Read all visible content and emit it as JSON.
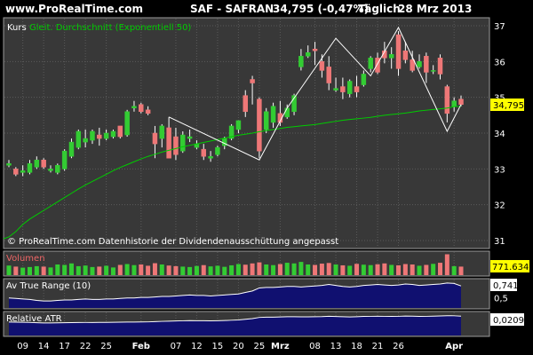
{
  "header": {
    "site": "www.ProRealTime.com",
    "symbol": "SAF - SAFRAN",
    "quote": "34,795 (-0,47%)",
    "period": "Täglich",
    "date": "28 Mrz 2013"
  },
  "colors": {
    "up": "#33cc33",
    "down": "#ee7777",
    "ema": "#00cc00",
    "zigzag": "#ffffff",
    "area": "#101070",
    "label_bg": "#ffff00"
  },
  "chart_data": [
    {
      "type": "candlestick",
      "legend": [
        "Kurs",
        "Gleit. Durchschnitt (Exponentiell 50)"
      ],
      "watermark": "© ProRealTime.com Datenhistorie der Dividendenausschüttung angepasst",
      "ylim": [
        31,
        37
      ],
      "yticks": [
        "31",
        "32",
        "33",
        "34",
        "35",
        "36",
        "37"
      ],
      "last_label": "34,795",
      "series": [
        {
          "name": "Kurs",
          "ohlc": [
            [
              33.1,
              33.25,
              33.05,
              33.15
            ],
            [
              33.0,
              33.05,
              32.8,
              32.85
            ],
            [
              32.9,
              33.1,
              32.8,
              32.95
            ],
            [
              32.9,
              33.25,
              32.85,
              33.15
            ],
            [
              33.05,
              33.35,
              33.0,
              33.25
            ],
            [
              33.25,
              33.3,
              33.0,
              33.05
            ],
            [
              32.95,
              33.1,
              32.9,
              33.0
            ],
            [
              32.9,
              33.15,
              32.85,
              33.1
            ],
            [
              33.0,
              33.55,
              32.95,
              33.5
            ],
            [
              33.35,
              33.85,
              33.3,
              33.75
            ],
            [
              33.6,
              34.1,
              33.55,
              34.05
            ],
            [
              33.75,
              34.1,
              33.6,
              33.85
            ],
            [
              33.8,
              34.1,
              33.7,
              34.05
            ],
            [
              33.95,
              34.15,
              33.65,
              33.85
            ],
            [
              33.85,
              34.1,
              33.8,
              34.0
            ],
            [
              33.9,
              34.1,
              33.85,
              34.05
            ],
            [
              34.2,
              34.2,
              33.85,
              33.9
            ],
            [
              33.95,
              34.65,
              33.9,
              34.6
            ],
            [
              34.7,
              34.9,
              34.6,
              34.75
            ],
            [
              34.8,
              34.85,
              34.55,
              34.6
            ],
            [
              34.65,
              34.75,
              34.5,
              34.55
            ],
            [
              34.0,
              34.2,
              33.3,
              33.7
            ],
            [
              33.85,
              34.25,
              33.6,
              34.2
            ],
            [
              34.15,
              34.45,
              33.5,
              33.3
            ],
            [
              33.9,
              34.15,
              33.25,
              33.4
            ],
            [
              33.5,
              34.05,
              33.45,
              33.95
            ],
            [
              33.85,
              34.1,
              33.75,
              33.9
            ],
            [
              33.6,
              33.8,
              33.55,
              33.7
            ],
            [
              33.55,
              33.7,
              33.25,
              33.35
            ],
            [
              33.3,
              33.5,
              33.2,
              33.35
            ],
            [
              33.4,
              33.65,
              33.35,
              33.6
            ],
            [
              33.65,
              33.9,
              33.55,
              33.85
            ],
            [
              33.85,
              34.25,
              33.8,
              34.2
            ],
            [
              34.1,
              34.35,
              34.0,
              34.35
            ],
            [
              35.05,
              35.2,
              34.45,
              34.6
            ],
            [
              35.5,
              35.6,
              34.8,
              35.4
            ],
            [
              34.95,
              35.0,
              33.3,
              33.5
            ],
            [
              34.1,
              34.7,
              34.0,
              34.6
            ],
            [
              34.3,
              34.85,
              34.15,
              34.75
            ],
            [
              34.55,
              34.9,
              34.2,
              34.3
            ],
            [
              34.45,
              34.8,
              34.4,
              34.7
            ],
            [
              34.6,
              35.1,
              34.5,
              35.05
            ],
            [
              35.85,
              36.35,
              35.75,
              36.15
            ],
            [
              36.15,
              36.45,
              36.1,
              36.25
            ],
            [
              36.35,
              36.55,
              35.9,
              36.3
            ],
            [
              36.0,
              36.2,
              35.55,
              35.75
            ],
            [
              35.85,
              36.15,
              35.2,
              35.4
            ],
            [
              35.2,
              35.55,
              35.15,
              35.25
            ],
            [
              35.3,
              35.55,
              34.95,
              35.15
            ],
            [
              35.1,
              35.5,
              35.0,
              35.45
            ],
            [
              35.3,
              35.6,
              35.0,
              35.15
            ],
            [
              35.35,
              35.75,
              35.3,
              35.65
            ],
            [
              35.8,
              36.15,
              35.7,
              36.1
            ],
            [
              36.1,
              36.25,
              35.65,
              35.7
            ],
            [
              36.3,
              36.55,
              35.95,
              36.1
            ],
            [
              36.1,
              36.4,
              35.8,
              36.2
            ],
            [
              36.75,
              36.85,
              35.6,
              35.8
            ],
            [
              36.3,
              36.55,
              35.95,
              36.05
            ],
            [
              36.05,
              36.3,
              35.7,
              35.75
            ],
            [
              35.85,
              36.2,
              35.8,
              36.0
            ],
            [
              36.15,
              36.25,
              35.4,
              35.7
            ],
            [
              35.75,
              35.9,
              35.65,
              35.75
            ],
            [
              36.1,
              36.2,
              35.5,
              35.65
            ],
            [
              35.3,
              35.35,
              34.3,
              34.55
            ],
            [
              34.75,
              35.0,
              34.6,
              34.9
            ],
            [
              34.95,
              35.05,
              34.75,
              34.8
            ]
          ]
        },
        {
          "name": "Gleit. Durchschnitt (Exponentiell 50)",
          "start": 31.05,
          "values": [
            31.1,
            31.25,
            31.45,
            31.6,
            31.72,
            31.84,
            31.96,
            32.08,
            32.2,
            32.32,
            32.44,
            32.55,
            32.65,
            32.75,
            32.85,
            32.95,
            33.04,
            33.12,
            33.2,
            33.28,
            33.35,
            33.41,
            33.47,
            33.52,
            33.57,
            33.62,
            33.66,
            33.7,
            33.74,
            33.78,
            33.82,
            33.86,
            33.9,
            33.94,
            33.97,
            34.0,
            34.04,
            34.07,
            34.1,
            34.13,
            34.16,
            34.18,
            34.2,
            34.22,
            34.24,
            34.27,
            34.3,
            34.33,
            34.36,
            34.38,
            34.4,
            34.42,
            34.44,
            34.47,
            34.5,
            34.52,
            34.54,
            34.56,
            34.59,
            34.62,
            34.64,
            34.66,
            34.68,
            34.7,
            34.74,
            34.75
          ]
        },
        {
          "name": "zigzag",
          "points": [
            [
              23,
              34.45
            ],
            [
              36,
              33.25
            ],
            [
              40,
              34.7
            ],
            [
              47,
              36.65
            ],
            [
              52,
              35.6
            ],
            [
              56,
              36.95
            ],
            [
              63,
              34.05
            ],
            [
              65,
              34.8
            ]
          ]
        }
      ]
    },
    {
      "type": "bar",
      "title": "Volumen",
      "last_label": "771.634",
      "values": [
        0.45,
        0.4,
        0.35,
        0.38,
        0.42,
        0.4,
        0.36,
        0.5,
        0.48,
        0.55,
        0.42,
        0.45,
        0.38,
        0.4,
        0.44,
        0.36,
        0.48,
        0.52,
        0.47,
        0.5,
        0.44,
        0.56,
        0.5,
        0.45,
        0.42,
        0.4,
        0.38,
        0.43,
        0.47,
        0.41,
        0.44,
        0.39,
        0.46,
        0.52,
        0.49,
        0.55,
        0.6,
        0.5,
        0.47,
        0.52,
        0.58,
        0.55,
        0.62,
        0.5,
        0.48,
        0.54,
        0.57,
        0.5,
        0.46,
        0.44,
        0.53,
        0.49,
        0.47,
        0.51,
        0.55,
        0.48,
        0.46,
        0.52,
        0.5,
        0.44,
        0.48,
        0.53,
        0.58,
        0.98,
        0.42,
        0.4
      ],
      "ylim": [
        0,
        1
      ]
    },
    {
      "type": "area",
      "title": "Av True Range (10)",
      "last_label": "0,741",
      "ylim": [
        0.3,
        0.85
      ],
      "yticks": [
        "0,5"
      ],
      "values": [
        0.5,
        0.49,
        0.48,
        0.47,
        0.45,
        0.44,
        0.44,
        0.45,
        0.46,
        0.46,
        0.47,
        0.48,
        0.47,
        0.47,
        0.48,
        0.48,
        0.49,
        0.5,
        0.5,
        0.51,
        0.51,
        0.52,
        0.53,
        0.53,
        0.54,
        0.55,
        0.56,
        0.55,
        0.55,
        0.54,
        0.55,
        0.56,
        0.57,
        0.58,
        0.61,
        0.64,
        0.7,
        0.71,
        0.71,
        0.72,
        0.73,
        0.73,
        0.72,
        0.73,
        0.74,
        0.75,
        0.77,
        0.75,
        0.73,
        0.72,
        0.73,
        0.75,
        0.76,
        0.77,
        0.76,
        0.75,
        0.76,
        0.78,
        0.77,
        0.75,
        0.76,
        0.77,
        0.78,
        0.8,
        0.79,
        0.74
      ]
    },
    {
      "type": "area",
      "title": "Relative ATR",
      "last_label": "0,0209",
      "ylim": [
        0.0,
        0.024
      ],
      "values": [
        0.0145,
        0.0144,
        0.0143,
        0.0141,
        0.0138,
        0.0136,
        0.0136,
        0.0137,
        0.0138,
        0.0139,
        0.014,
        0.0141,
        0.0141,
        0.0142,
        0.0142,
        0.0143,
        0.0144,
        0.0145,
        0.0145,
        0.0146,
        0.0147,
        0.015,
        0.0153,
        0.0155,
        0.0157,
        0.0159,
        0.0161,
        0.016,
        0.016,
        0.0158,
        0.016,
        0.0162,
        0.0165,
        0.0168,
        0.0175,
        0.0182,
        0.0195,
        0.0198,
        0.0198,
        0.02,
        0.0203,
        0.0203,
        0.0202,
        0.0202,
        0.0203,
        0.0204,
        0.0207,
        0.0205,
        0.0203,
        0.0201,
        0.0203,
        0.0206,
        0.0207,
        0.0208,
        0.0207,
        0.0206,
        0.0207,
        0.021,
        0.0209,
        0.0206,
        0.0207,
        0.0209,
        0.0211,
        0.0214,
        0.0213,
        0.0209
      ]
    }
  ],
  "xaxis": {
    "labels": [
      {
        "text": "09",
        "i": 2,
        "bold": false
      },
      {
        "text": "14",
        "i": 5,
        "bold": false
      },
      {
        "text": "17",
        "i": 8,
        "bold": false
      },
      {
        "text": "22",
        "i": 11,
        "bold": false
      },
      {
        "text": "25",
        "i": 14,
        "bold": false
      },
      {
        "text": "Feb",
        "i": 19,
        "bold": true
      },
      {
        "text": "07",
        "i": 24,
        "bold": false
      },
      {
        "text": "12",
        "i": 27,
        "bold": false
      },
      {
        "text": "15",
        "i": 30,
        "bold": false
      },
      {
        "text": "20",
        "i": 33,
        "bold": false
      },
      {
        "text": "25",
        "i": 36,
        "bold": false
      },
      {
        "text": "Mrz",
        "i": 39,
        "bold": true
      },
      {
        "text": "08",
        "i": 44,
        "bold": false
      },
      {
        "text": "13",
        "i": 47,
        "bold": false
      },
      {
        "text": "18",
        "i": 50,
        "bold": false
      },
      {
        "text": "21",
        "i": 53,
        "bold": false
      },
      {
        "text": "26",
        "i": 56,
        "bold": false
      },
      {
        "text": "Apr",
        "i": 64,
        "bold": true
      }
    ]
  }
}
